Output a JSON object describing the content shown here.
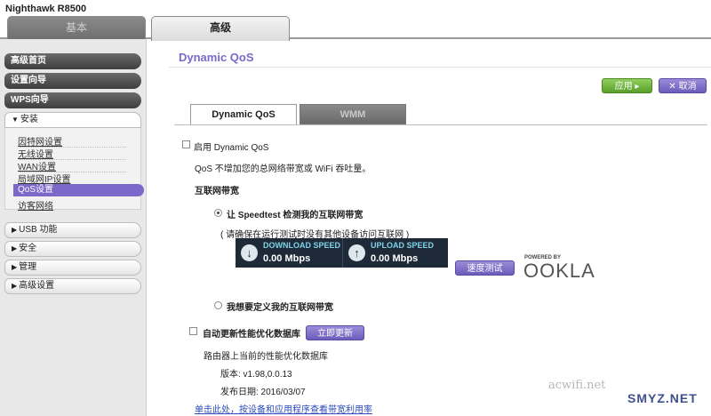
{
  "header": {
    "brand": "Nighthawk R8500",
    "tabs": [
      {
        "label": "基本",
        "active": false
      },
      {
        "label": "高级",
        "active": true
      }
    ]
  },
  "sidebar": {
    "top_items": [
      "高级首页",
      "设置向导",
      "WPS向导"
    ],
    "open_section": "安装",
    "sub_items": [
      "因特网设置",
      "无线设置",
      "WAN设置",
      "局域网IP设置",
      "QoS设置",
      "访客网络"
    ],
    "active_sub": "QoS设置",
    "collapsed_sections": [
      "USB 功能",
      "安全",
      "管理",
      "高级设置"
    ]
  },
  "main": {
    "title": "Dynamic QoS",
    "apply_label": "应用 ▸",
    "cancel_label": "✕ 取消",
    "tabs": [
      {
        "label": "Dynamic QoS",
        "active": true
      },
      {
        "label": "WMM",
        "active": false
      }
    ],
    "enable_label": "启用 Dynamic QoS",
    "enable_checked": false,
    "enable_desc": "QoS 不增加您的总网络带宽或 WiFi 吞吐量。",
    "bandwidth_heading": "互联网带宽",
    "radio_speedtest": "让 Speedtest 检测我的互联网带宽",
    "radio_speedtest_selected": true,
    "speedtest_note": "( 请确保在运行测试时没有其他设备访问互联网 )",
    "download_label": "DOWNLOAD SPEED",
    "download_value": "0.00 Mbps",
    "upload_label": "UPLOAD SPEED",
    "upload_value": "0.00 Mbps",
    "test_button": "速度测试",
    "powered_by": "POWERED BY",
    "ookla_logo": "OOKLA",
    "radio_custom": "我想要定义我的互联网带宽",
    "radio_custom_selected": false,
    "auto_update_label": "自动更新性能优化数据库",
    "auto_update_checked": false,
    "update_button": "立即更新",
    "db_heading": "路由器上当前的性能优化数据库",
    "version": "版本: v1.98,0.0.13",
    "release_date": "发布日期: 2016/03/07",
    "link_text": "单击此处，按设备和应用程序查看带宽利用率"
  },
  "watermarks": [
    "acwifi.net",
    "SMYZ.NET"
  ],
  "colors": {
    "accent": "#7b68c8",
    "apply_green": "#5a9e28",
    "speed_bg": "#1e2a38"
  }
}
